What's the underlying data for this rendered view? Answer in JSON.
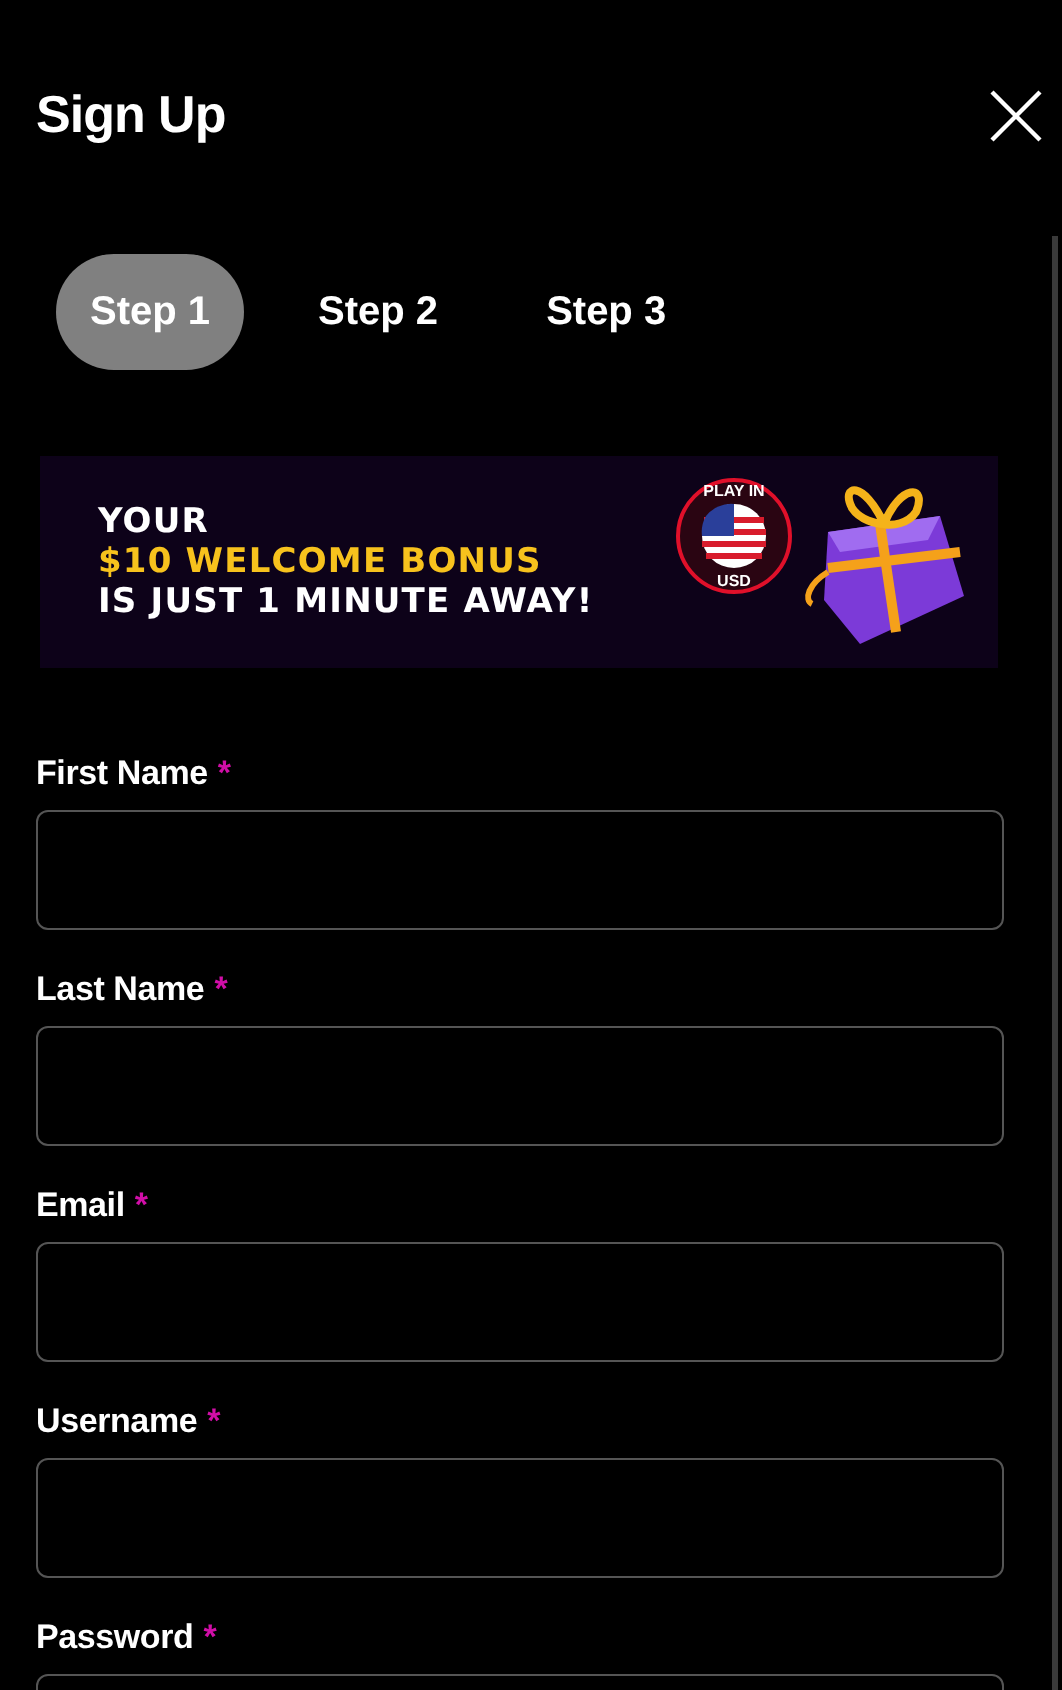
{
  "header": {
    "title": "Sign Up"
  },
  "steps": [
    {
      "label": "Step 1",
      "selected": true
    },
    {
      "label": "Step 2",
      "selected": false
    },
    {
      "label": "Step 3",
      "selected": false
    }
  ],
  "banner": {
    "lines": [
      {
        "text": "YOUR",
        "kind": "plain"
      },
      {
        "text": "$10 WELCOME BONUS",
        "kind": "highlight"
      },
      {
        "text": "IS JUST 1 MINUTE AWAY!",
        "kind": "plain"
      }
    ],
    "badge": {
      "top": "PLAY IN",
      "bottom": "USD"
    }
  },
  "fields": [
    {
      "label": "First Name",
      "required_mark": "*"
    },
    {
      "label": "Last Name",
      "required_mark": "*"
    },
    {
      "label": "Email",
      "required_mark": "*"
    },
    {
      "label": "Username",
      "required_mark": "*"
    },
    {
      "label": "Password",
      "required_mark": "*"
    }
  ]
}
